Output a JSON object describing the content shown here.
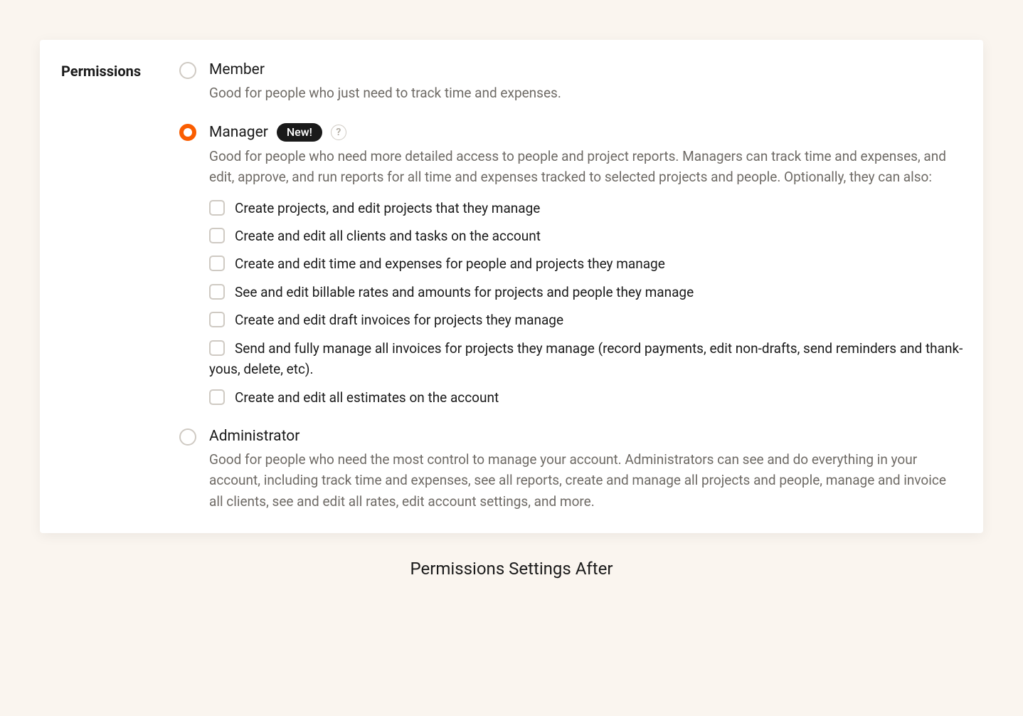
{
  "sectionLabel": "Permissions",
  "caption": "Permissions Settings After",
  "badgeNew": "New!",
  "helpGlyph": "?",
  "roles": {
    "member": {
      "title": "Member",
      "description": "Good for people who just need to track time and expenses."
    },
    "manager": {
      "title": "Manager",
      "description": "Good for people who need more detailed access to people and project reports. Managers can track time and expenses, and edit, approve, and run reports for all time and expenses tracked to selected projects and people. Optionally, they can also:",
      "options": [
        "Create projects, and edit projects that they manage",
        "Create and edit all clients and tasks on the account",
        "Create and edit time and expenses for people and projects they manage",
        "See and edit billable rates and amounts for projects and people they manage",
        "Create and edit draft invoices for projects they manage",
        "Send and fully manage all invoices for projects they manage (record payments, edit non-drafts, send reminders and thank-yous, delete, etc).",
        "Create and edit all estimates on the account"
      ]
    },
    "administrator": {
      "title": "Administrator",
      "description": "Good for people who need the most control to manage your account. Administrators can see and do everything in your account, including track time and expenses, see all reports, create and manage all projects and people, manage and invoice all clients, see and edit all rates, edit account settings, and more."
    }
  }
}
